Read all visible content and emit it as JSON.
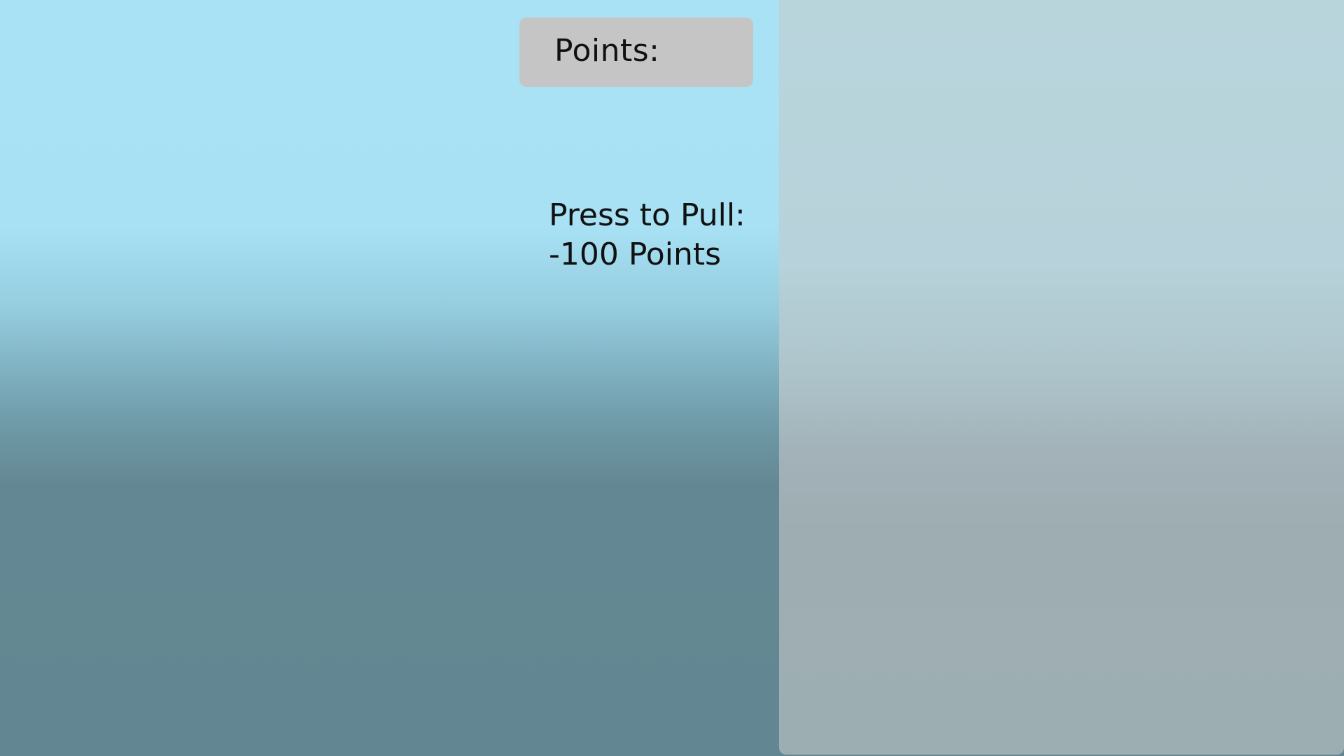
{
  "points": {
    "label": "Points:"
  },
  "pull": {
    "line1": "Press to Pull:",
    "line2": "-100 Points"
  },
  "colors": {
    "sky_top": "#a8e2f4",
    "sky_bottom": "#628792",
    "points_box": "#c5c5c5",
    "panel_top": "#b9d5dc",
    "panel_bottom": "#9daeb3",
    "text": "#111111"
  }
}
